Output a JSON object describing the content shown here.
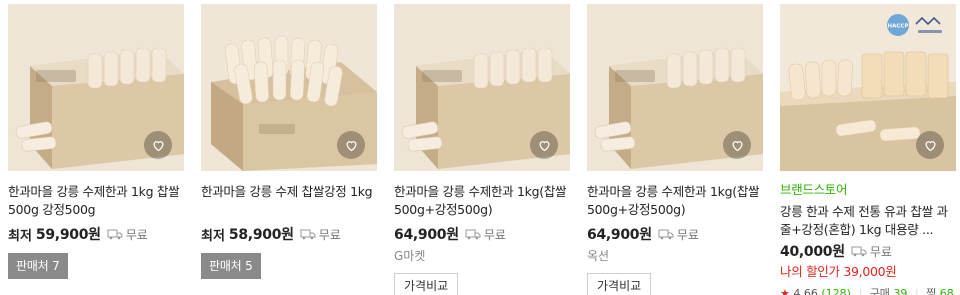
{
  "products": [
    {
      "title": "한과마을 강릉 수제한과 1kg 찹쌀500g 강정500g",
      "price_prefix": "최저",
      "price": "59,900원",
      "shipping": "무료",
      "seller_button": "판매처 7"
    },
    {
      "title": "한과마을 강릉 수제 찹쌀강정 1kg",
      "price_prefix": "최저",
      "price": "58,900원",
      "shipping": "무료",
      "seller_button": "판매처 5"
    },
    {
      "title": "한과마을 강릉 수제한과 1kg(찹쌀500g+강정500g)",
      "price": "64,900원",
      "shipping": "무료",
      "mall": "G마켓",
      "compare_button": "가격비교"
    },
    {
      "title": "한과마을 강릉 수제한과 1kg(찹쌀500g+강정500g)",
      "price": "64,900원",
      "shipping": "무료",
      "mall": "옥션",
      "compare_button": "가격비교"
    },
    {
      "store_label": "브랜드스토어",
      "title": "강릉 한과 수제 전통 유과 찹쌀 과줄+강정(혼합) 1kg 대용량 ...",
      "price": "40,000원",
      "shipping": "무료",
      "discount_text": "나의 할인가 39,000원",
      "rating": "4.66",
      "review_count": "(128)",
      "purchase_label": "구매",
      "purchase_count": "39",
      "zzim_label": "찜",
      "zzim_count": "68",
      "badge_text": "HACCP"
    }
  ],
  "icons": {
    "heart": "heart-icon",
    "truck": "truck-icon",
    "star": "star-icon"
  },
  "colors": {
    "green": "#2db400",
    "red": "#e0241e",
    "seller_button_bg": "#8a8a8a"
  }
}
